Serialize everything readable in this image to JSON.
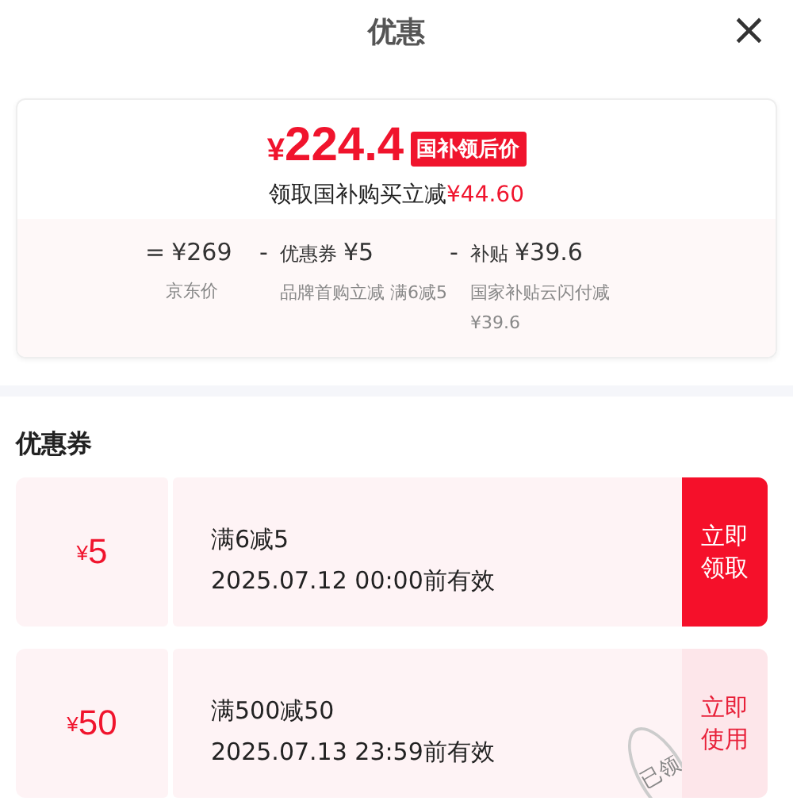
{
  "header": {
    "title": "优惠",
    "close": "×"
  },
  "summary": {
    "currency": "¥",
    "price": "224.4",
    "badge": "国补领后价",
    "subtitle": "领取国补购买立减**¥44.60**",
    "breakdown": [
      {
        "operator": "=",
        "value": "¥269",
        "note": "京东价"
      },
      {
        "operator": "-",
        "label": "优惠券",
        "value": "¥5",
        "note": "品牌首购立减 满6减5"
      },
      {
        "operator": "-",
        "label": "补贴",
        "value": "¥39.6",
        "note": "国家补贴云闪付减¥39.6"
      }
    ]
  },
  "coupons_section": {
    "title": "优惠券",
    "coupons": [
      {
        "currency": "¥",
        "amount": "5",
        "condition": "满6减5",
        "validity": "2025.07.12 00:00前有效",
        "action": "立即领取",
        "claimed": false
      },
      {
        "currency": "¥",
        "amount": "50",
        "condition": "满500减50",
        "validity": "2025.07.13 23:59前有效",
        "action": "立即使用",
        "claimed": true,
        "stamp": "已领"
      }
    ]
  }
}
